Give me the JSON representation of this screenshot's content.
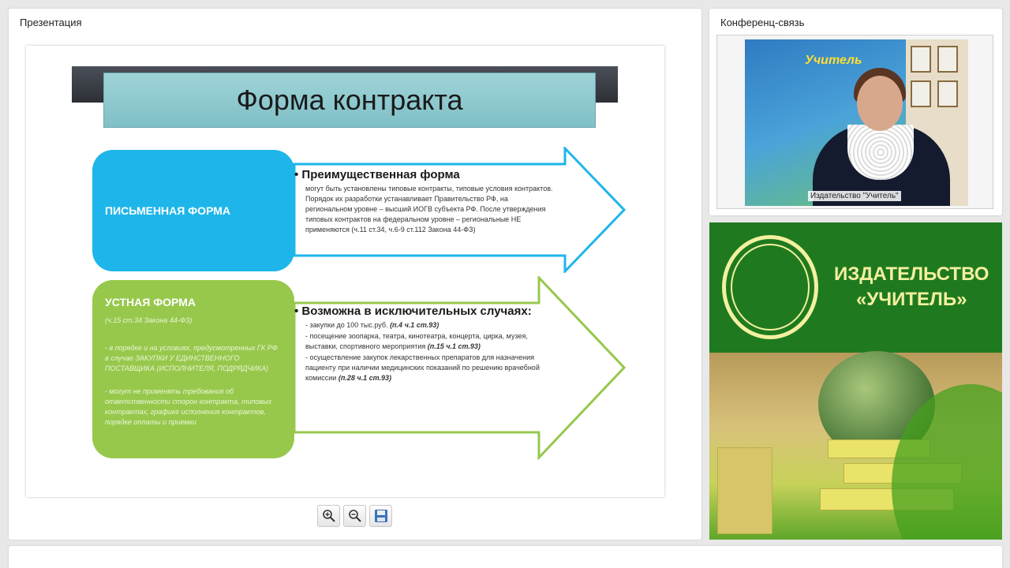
{
  "panels": {
    "presentation_title": "Презентация",
    "conference_title": "Конференц-связь"
  },
  "slide": {
    "title": "Форма контракта",
    "block1": {
      "label": "ПИСЬМЕННАЯ ФОРМА",
      "heading": "Преимущественная форма",
      "body": "могут быть установлены типовые контракты, типовые условия контрактов. Порядок их разработки устанавливает Правительство РФ, на региональном уровне – высший ИОГВ субъекта РФ. После утверждения типовых контрактов на федеральном уровне – региональные НЕ применяются (ч.11 ст.34, ч.6-9 ст.112 Закона 44-ФЗ)"
    },
    "block2": {
      "label": "УСТНАЯ ФОРМА",
      "ref": "(ч.15 ст.34 Закона 44-ФЗ)",
      "note1": "- в порядке и на условиях, предусмотренных ГК РФ в случае ЗАКУПКИ У ЕДИНСТВЕННОГО ПОСТАВЩИКА (ИСПОЛНИТЕЛЯ, ПОДРЯДЧИКА)",
      "note2": "- могут не применять требования об ответственности сторон контракта, типовых контрактах, графике исполнения контрактов, порядке оплаты и приемки",
      "heading": "Возможна в исключительных случаях:",
      "items": [
        {
          "text": "- закупки до 100 тыс.руб.",
          "ref": "(п.4 ч.1 ст.93)"
        },
        {
          "text": "- посещение зоопарка, театра, кинотеатра, концерта, цирка, музея, выставки, спортивного мероприятия",
          "ref": "(п.15 ч.1 ст.93)"
        },
        {
          "text": "- осуществление закупок лекарственных препаратов для назначения пациенту при наличии медицинских показаний по решению врачебной комиссии",
          "ref": "(п.28 ч.1 ст.93)"
        }
      ]
    }
  },
  "toolbar": {
    "zoom_in_icon": "zoom-in-icon",
    "zoom_out_icon": "zoom-out-icon",
    "save_icon": "floppy-disk-icon"
  },
  "video": {
    "caption": "Издательство \"Учитель\"",
    "banner_text": "Учитель"
  },
  "ad": {
    "line1": "ИЗДАТЕЛЬСТВО",
    "line2": "«УЧИТЕЛЬ»"
  },
  "colors": {
    "blue_block": "#1eb6ea",
    "green_block": "#97c84c",
    "ad_green": "#1f7a1f"
  }
}
